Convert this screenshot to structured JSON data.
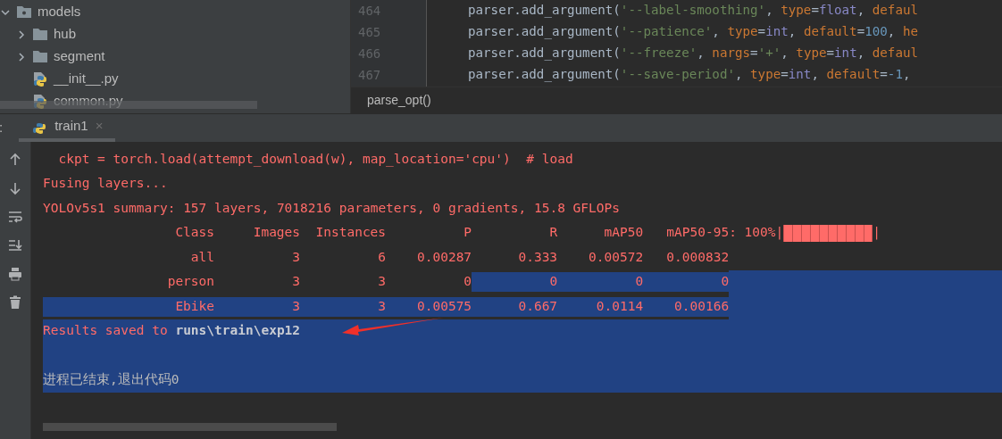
{
  "project_tree": {
    "items": [
      {
        "label": "models",
        "kind": "module_folder",
        "expanded": true,
        "children": [
          {
            "label": "hub",
            "kind": "folder",
            "expanded": false
          },
          {
            "label": "segment",
            "kind": "folder",
            "expanded": false
          },
          {
            "label": "__init__.py",
            "kind": "python_file"
          },
          {
            "label": "common.py",
            "kind": "python_file"
          }
        ]
      }
    ]
  },
  "editor": {
    "lines": [
      {
        "number": "464",
        "tokens": [
          {
            "text": "parser.add_argument(",
            "kind": "plain"
          },
          {
            "text": "'--label-smoothing'",
            "kind": "string"
          },
          {
            "text": ", ",
            "kind": "plain"
          },
          {
            "text": "type",
            "kind": "keyword"
          },
          {
            "text": "=",
            "kind": "plain"
          },
          {
            "text": "float",
            "kind": "builtin"
          },
          {
            "text": ", ",
            "kind": "plain"
          },
          {
            "text": "defaul",
            "kind": "keyword"
          }
        ]
      },
      {
        "number": "465",
        "tokens": [
          {
            "text": "parser.add_argument(",
            "kind": "plain"
          },
          {
            "text": "'--patience'",
            "kind": "string"
          },
          {
            "text": ", ",
            "kind": "plain"
          },
          {
            "text": "type",
            "kind": "keyword"
          },
          {
            "text": "=",
            "kind": "plain"
          },
          {
            "text": "int",
            "kind": "builtin"
          },
          {
            "text": ", ",
            "kind": "plain"
          },
          {
            "text": "default",
            "kind": "keyword"
          },
          {
            "text": "=",
            "kind": "plain"
          },
          {
            "text": "100",
            "kind": "number"
          },
          {
            "text": ", ",
            "kind": "plain"
          },
          {
            "text": "he",
            "kind": "keyword"
          }
        ]
      },
      {
        "number": "466",
        "tokens": [
          {
            "text": "parser.add_argument(",
            "kind": "plain"
          },
          {
            "text": "'--freeze'",
            "kind": "string"
          },
          {
            "text": ", ",
            "kind": "plain"
          },
          {
            "text": "nargs",
            "kind": "keyword"
          },
          {
            "text": "=",
            "kind": "plain"
          },
          {
            "text": "'+'",
            "kind": "string"
          },
          {
            "text": ", ",
            "kind": "plain"
          },
          {
            "text": "type",
            "kind": "keyword"
          },
          {
            "text": "=",
            "kind": "plain"
          },
          {
            "text": "int",
            "kind": "builtin"
          },
          {
            "text": ", ",
            "kind": "plain"
          },
          {
            "text": "defaul",
            "kind": "keyword"
          }
        ]
      },
      {
        "number": "467",
        "tokens": [
          {
            "text": "parser.add_argument(",
            "kind": "plain"
          },
          {
            "text": "'--save-period'",
            "kind": "string"
          },
          {
            "text": ", ",
            "kind": "plain"
          },
          {
            "text": "type",
            "kind": "keyword"
          },
          {
            "text": "=",
            "kind": "plain"
          },
          {
            "text": "int",
            "kind": "builtin"
          },
          {
            "text": ", ",
            "kind": "plain"
          },
          {
            "text": "default",
            "kind": "keyword"
          },
          {
            "text": "=",
            "kind": "plain"
          },
          {
            "text": "-1",
            "kind": "number"
          },
          {
            "text": ",",
            "kind": "plain"
          }
        ]
      }
    ],
    "breadcrumb": "parse_opt()"
  },
  "run_panel": {
    "label": ":",
    "tabs": [
      {
        "label": "train1",
        "close": "×",
        "selected": true
      }
    ]
  },
  "console": {
    "lines": [
      {
        "kind": "error",
        "text": "  ckpt = torch.load(attempt_download(w), map_location='cpu')  # load",
        "selected": false
      },
      {
        "kind": "error",
        "text": "Fusing layers...",
        "selected": false
      },
      {
        "kind": "error",
        "text": "YOLOv5s1 summary: 157 layers, 7018216 parameters, 0 gradients, 15.8 GFLOPs",
        "selected": false
      },
      {
        "kind": "table_header",
        "cells": [
          {
            "text": "Class",
            "selected": false
          },
          {
            "text": "Images",
            "selected": false
          },
          {
            "text": "Instances",
            "selected": false
          },
          {
            "text": "P",
            "selected": false
          },
          {
            "text": "R",
            "selected": false
          },
          {
            "text": "mAP50",
            "selected": false
          },
          {
            "text": "mAP50-95: 100%|",
            "selected": false
          }
        ],
        "progress": {
          "level": 1
        },
        "tail": "|"
      },
      {
        "kind": "table_row",
        "cells": [
          {
            "text": "all",
            "selected": false
          },
          {
            "text": "3",
            "selected": false
          },
          {
            "text": "6",
            "selected": false
          },
          {
            "text": "0.00287",
            "selected": false
          },
          {
            "text": "0.333",
            "selected": false
          },
          {
            "text": "0.00572",
            "selected": false
          },
          {
            "text": "0.000832",
            "selected": false
          }
        ],
        "selected": false
      },
      {
        "kind": "table_row",
        "cells": [
          {
            "text": "person",
            "selected": false
          },
          {
            "text": "3",
            "selected": false
          },
          {
            "text": "3",
            "selected": false
          },
          {
            "text": "0",
            "selected": false
          },
          {
            "text": "0",
            "selected": true
          },
          {
            "text": "0",
            "selected": true
          },
          {
            "text": "0",
            "selected": true
          }
        ],
        "selected": true
      },
      {
        "kind": "table_row",
        "cells": [
          {
            "text": "Ebike",
            "selected": true
          },
          {
            "text": "3",
            "selected": true
          },
          {
            "text": "3",
            "selected": true
          },
          {
            "text": "0.00575",
            "selected": true
          },
          {
            "text": "0.667",
            "selected": true
          },
          {
            "text": "0.0114",
            "selected": true
          },
          {
            "text": "0.00166",
            "selected": true
          }
        ],
        "selected": true
      },
      {
        "kind": "error",
        "text": "Results saved to **runs\\train\\exp12**",
        "selected": true
      },
      {
        "kind": "blank",
        "selected": true
      },
      {
        "kind": "output",
        "text": "进程已结束,退出代码0",
        "selected": true
      }
    ]
  }
}
